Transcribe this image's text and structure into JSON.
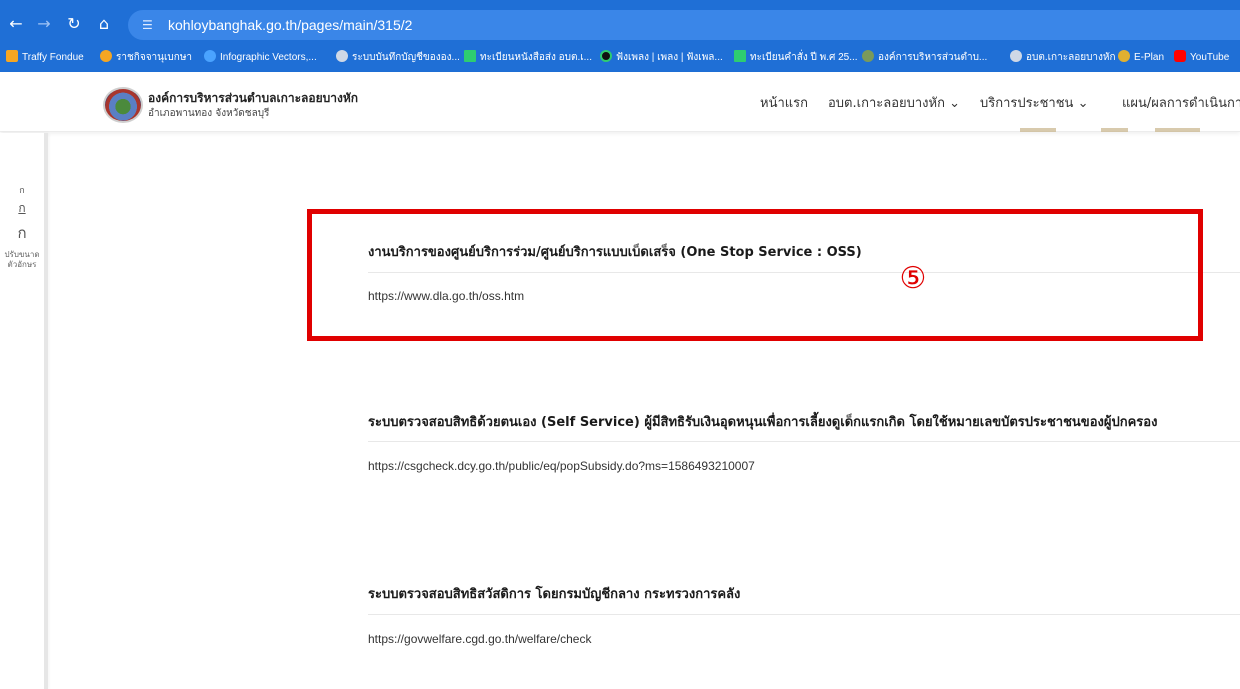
{
  "browser": {
    "url": "kohloybanghak.go.th/pages/main/315/2",
    "bookmarks": [
      {
        "label": "Traffy Fondue",
        "color": "#f5a623"
      },
      {
        "label": "ราชกิจจานุเบกษา",
        "color": "#f5a623"
      },
      {
        "label": "Infographic Vectors,...",
        "color": "#4aa3ff"
      },
      {
        "label": "ระบบบันทึกบัญชีขององ...",
        "color": "#cfd8e6"
      },
      {
        "label": "ทะเบียนหนังสือส่ง อบต.เ...",
        "color": "#2ecc71"
      },
      {
        "label": "ฟังเพลง | เพลง | ฟังเพล...",
        "color": "#111111"
      },
      {
        "label": "ทะเบียนคำสั่ง ปี พ.ศ 25...",
        "color": "#2ecc71"
      },
      {
        "label": "องค์การบริหารส่วนตำบ...",
        "color": "#7a9a5a"
      },
      {
        "label": "อบต.เกาะลอยบางหัก",
        "color": "#cfd8e6"
      },
      {
        "label": "E-Plan",
        "color": "#e0b030"
      },
      {
        "label": "YouTube",
        "color": "#ff0000"
      }
    ]
  },
  "site": {
    "title": "องค์การบริหารส่วนตำบลเกาะลอยบางหัก",
    "subtitle": "อำเภอพานทอง จังหวัดชลบุรี",
    "nav": [
      {
        "label": "หน้าแรก"
      },
      {
        "label": "อบต.เกาะลอยบางหัก",
        "caret": "⌄"
      },
      {
        "label": "บริการประชาชน",
        "caret": "⌄"
      },
      {
        "label": "แผน/ผลการดำเนินการ",
        "caret": "⌄"
      }
    ]
  },
  "accessibility": {
    "small": "ก",
    "medium": "ก",
    "large": "ก",
    "label": "ปรับขนาดตัวอักษร"
  },
  "items": [
    {
      "title": "งานบริการของศูนย์บริการร่วม/ศูนย์บริการแบบเบ็ดเสร็จ (One Stop Service : OSS)",
      "link": "https://www.dla.go.th/oss.htm"
    },
    {
      "title": "ระบบตรวจสอบสิทธิด้วยตนเอง (Self Service) ผู้มีสิทธิรับเงินอุดหนุนเพื่อการเลี้ยงดูเด็กแรกเกิด โดยใช้หมายเลขบัตรประชาชนของผู้ปกครอง",
      "link": "https://csgcheck.dcy.go.th/public/eq/popSubsidy.do?ms=1586493210007"
    },
    {
      "title": "ระบบตรวจสอบสิทธิสวัสดิการ โดยกรมบัญชีกลาง กระทรวงการคลัง",
      "link": "https://govwelfare.cgd.go.th/welfare/check"
    }
  ],
  "annotation": {
    "marker": "⑤",
    "color": "#e00000"
  }
}
